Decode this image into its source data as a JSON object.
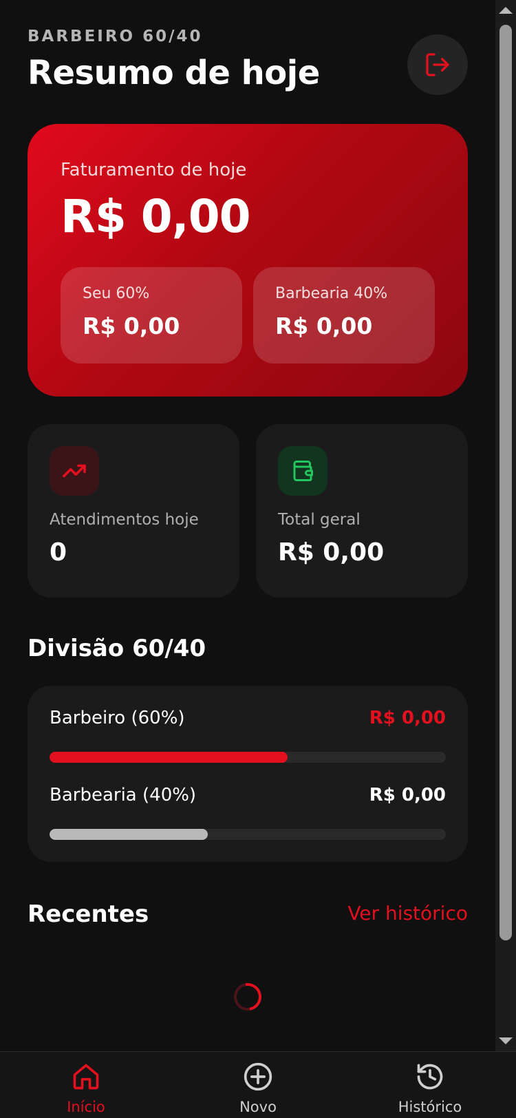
{
  "header": {
    "eyebrow": "BARBEIRO 60/40",
    "title": "Resumo de hoje",
    "logout_icon": "logout-icon"
  },
  "hero": {
    "label": "Faturamento de hoje",
    "value": "R$ 0,00",
    "splits": [
      {
        "label": "Seu 60%",
        "value": "R$ 0,00"
      },
      {
        "label": "Barbearia 40%",
        "value": "R$ 0,00"
      }
    ]
  },
  "stats": [
    {
      "icon": "trending-up-icon",
      "label": "Atendimentos hoje",
      "value": "0"
    },
    {
      "icon": "wallet-icon",
      "label": "Total geral",
      "value": "R$ 0,00"
    }
  ],
  "division": {
    "title": "Divisão 60/40",
    "rows": [
      {
        "label": "Barbeiro (60%)",
        "value": "R$ 0,00",
        "fill_percent": 60
      },
      {
        "label": "Barbearia (40%)",
        "value": "R$ 0,00",
        "fill_percent": 40
      }
    ]
  },
  "recent": {
    "title": "Recentes",
    "link": "Ver histórico",
    "loading": true
  },
  "nav": [
    {
      "label": "Início",
      "icon": "home-icon",
      "active": true
    },
    {
      "label": "Novo",
      "icon": "plus-circle-icon",
      "active": false
    },
    {
      "label": "Histórico",
      "icon": "history-icon",
      "active": false
    }
  ],
  "colors": {
    "accent": "#e3101f",
    "background": "#101010",
    "card": "#1b1b1b",
    "green": "#22c55e"
  }
}
